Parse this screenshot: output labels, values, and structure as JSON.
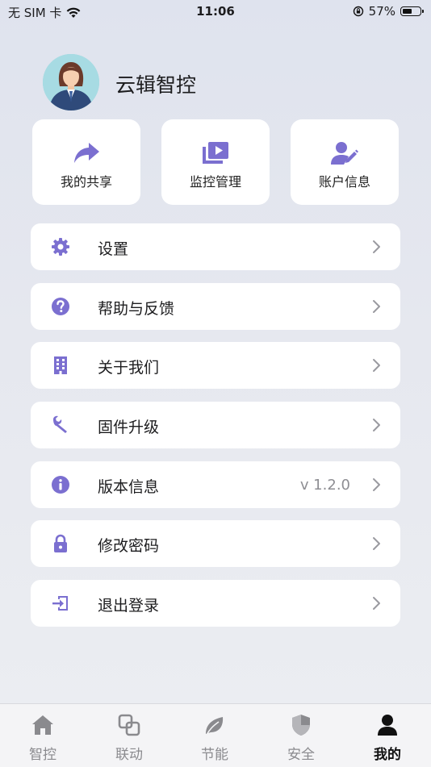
{
  "status_bar": {
    "carrier": "无 SIM 卡",
    "time": "11:06",
    "battery_percent": "57%",
    "battery_level": 0.57
  },
  "profile": {
    "name": "云辑智控"
  },
  "quick_actions": [
    {
      "label": "我的共享",
      "icon": "share-icon"
    },
    {
      "label": "监控管理",
      "icon": "video-library-icon"
    },
    {
      "label": "账户信息",
      "icon": "account-edit-icon"
    }
  ],
  "menu": [
    {
      "label": "设置",
      "icon": "gear-icon",
      "value": ""
    },
    {
      "label": "帮助与反馈",
      "icon": "help-icon",
      "value": ""
    },
    {
      "label": "关于我们",
      "icon": "building-icon",
      "value": ""
    },
    {
      "label": "固件升级",
      "icon": "wrench-icon",
      "value": ""
    },
    {
      "label": "版本信息",
      "icon": "info-icon",
      "value": "v 1.2.0"
    },
    {
      "label": "修改密码",
      "icon": "lock-icon",
      "value": ""
    },
    {
      "label": "退出登录",
      "icon": "logout-icon",
      "value": ""
    }
  ],
  "tabs": [
    {
      "label": "智控",
      "icon": "home-icon",
      "active": false
    },
    {
      "label": "联动",
      "icon": "link-squares-icon",
      "active": false
    },
    {
      "label": "节能",
      "icon": "leaf-icon",
      "active": false
    },
    {
      "label": "安全",
      "icon": "shield-icon",
      "active": false
    },
    {
      "label": "我的",
      "icon": "person-icon",
      "active": true
    }
  ],
  "colors": {
    "accent": "#7b6fd0",
    "chevron": "#9a9aa0",
    "tab_inactive": "#8a8a8e",
    "tab_active": "#111111"
  }
}
